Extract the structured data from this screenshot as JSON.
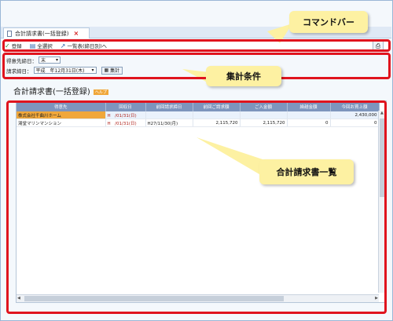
{
  "tab": {
    "title": "合計請求書(一括登録)",
    "close": "×"
  },
  "toolbar": {
    "register": "登録",
    "select_all": "全選択",
    "to_list": "一覧表(締日別)へ"
  },
  "conditions": {
    "label_customer_closing": "得意先締日：",
    "customer_closing_value": "末",
    "label_billing_closing": "請求締日：",
    "billing_closing_value": "平成　年12月31日(木)",
    "tally_button": "集計"
  },
  "page": {
    "title": "合計請求書(一括登録)",
    "badge": "ヘルプ"
  },
  "grid": {
    "columns": [
      "得意先",
      "回収日",
      "前回請求締日",
      "前回ご請求額",
      "ご入金額",
      "繰越金額",
      "今回お買上額"
    ],
    "rows": [
      [
        "株式会社千曲川ホーム",
        "H　/01/31(日)",
        "",
        "",
        "",
        "",
        "2,430,000"
      ],
      [
        "湯堂マリンマンション",
        "H　/01/31(日)",
        "H27/11/30(月)",
        "2,115,720",
        "2,115,720",
        "0",
        "0"
      ]
    ]
  },
  "callouts": {
    "command_bar": "コマンドバー",
    "conditions": "集計条件",
    "list": "合計請求書一覧"
  },
  "colors": {
    "annotation_red": "#e0141e",
    "callout_yellow": "#fdf1a2",
    "header_blue": "#7d95bd",
    "highlight_orange": "#f0a73a"
  }
}
